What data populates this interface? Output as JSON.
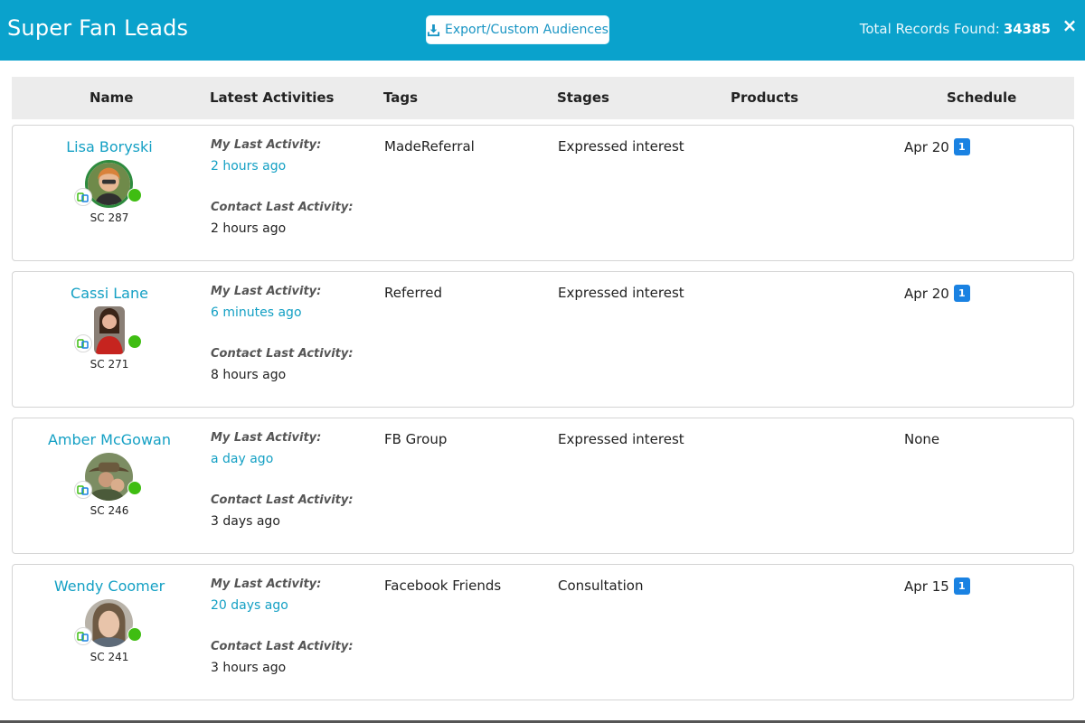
{
  "header": {
    "title": "Super Fan Leads",
    "export_label": "Export/Custom Audiences",
    "total_label": "Total Records Found:",
    "total_count": "34385",
    "close_icon": "×"
  },
  "columns": [
    "Name",
    "Latest Activities",
    "Tags",
    "Stages",
    "Products",
    "Schedule"
  ],
  "activity_labels": {
    "my_last": "My Last Activity:",
    "contact_last": "Contact Last Activity:"
  },
  "rows": [
    {
      "name": "Lisa Boryski",
      "sc": "SC 287",
      "my_last_activity": "2 hours ago",
      "contact_last_activity": "2 hours ago",
      "tag": "MadeReferral",
      "stage": "Expressed interest",
      "product": "",
      "schedule": "Apr 20",
      "schedule_badge": "1"
    },
    {
      "name": "Cassi Lane",
      "sc": "SC 271",
      "my_last_activity": "6 minutes ago",
      "contact_last_activity": "8 hours ago",
      "tag": "Referred",
      "stage": "Expressed interest",
      "product": "",
      "schedule": "Apr 20",
      "schedule_badge": "1"
    },
    {
      "name": "Amber McGowan",
      "sc": "SC 246",
      "my_last_activity": "a day ago",
      "contact_last_activity": "3 days ago",
      "tag": "FB Group",
      "stage": "Expressed interest",
      "product": "",
      "schedule": "None",
      "schedule_badge": ""
    },
    {
      "name": "Wendy Coomer",
      "sc": "SC 241",
      "my_last_activity": "20 days ago",
      "contact_last_activity": "3 hours ago",
      "tag": "Facebook Friends",
      "stage": "Consultation",
      "product": "",
      "schedule": "Apr 15",
      "schedule_badge": "1"
    }
  ],
  "colors": {
    "header_bg": "#0aa2cc",
    "link": "#14a0c4",
    "online": "#3fbd12",
    "badge": "#1a82e2"
  }
}
